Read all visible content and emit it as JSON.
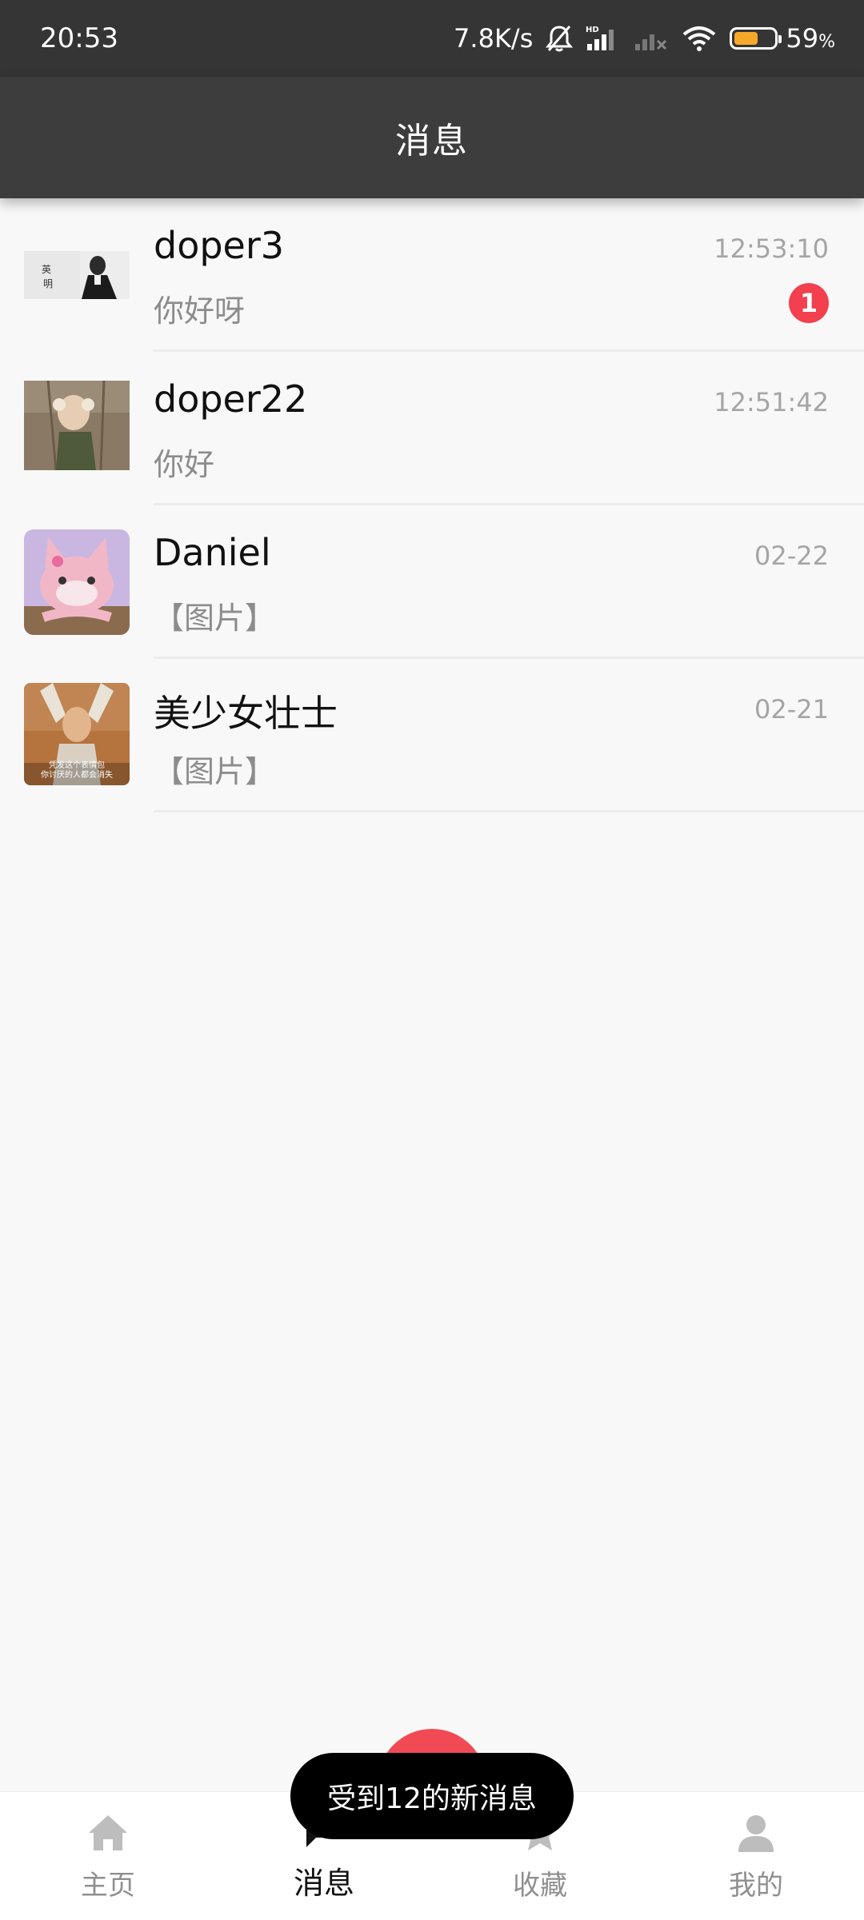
{
  "status_bar": {
    "time": "20:53",
    "network_speed": "7.8K/s",
    "battery_percent": "59",
    "battery_unit": "%",
    "battery_level": 0.59,
    "icons": [
      "bell-muted-icon",
      "hd-signal-icon",
      "signal-off-icon",
      "wifi-icon",
      "battery-icon"
    ]
  },
  "header": {
    "title": "消息"
  },
  "conversations": [
    {
      "name": "doper3",
      "preview": "你好呀",
      "time": "12:53:10",
      "unread": "1"
    },
    {
      "name": "doper22",
      "preview": "你好",
      "time": "12:51:42",
      "unread": ""
    },
    {
      "name": "Daniel",
      "preview": "【图片】",
      "time": "02-22",
      "unread": ""
    },
    {
      "name": "美少女壮士",
      "preview": "【图片】",
      "time": "02-21",
      "unread": ""
    }
  ],
  "avatars": {
    "0": {
      "caption_1": "英",
      "caption_2": "明"
    },
    "3": {
      "caption": "凭发这个表情包\n你讨厌的人都会消失"
    }
  },
  "bottom_nav": {
    "items": [
      {
        "label": "主页",
        "icon": "home-icon"
      },
      {
        "label": "消息",
        "icon": "chat-icon",
        "active": true
      },
      {
        "label": "收藏",
        "icon": "star-icon"
      },
      {
        "label": "我的",
        "icon": "person-icon"
      }
    ]
  },
  "toast": {
    "text": "受到12的新消息"
  },
  "colors": {
    "accent": "#f24a55",
    "header_bg": "#3d3d3d",
    "status_bg": "#353535"
  }
}
